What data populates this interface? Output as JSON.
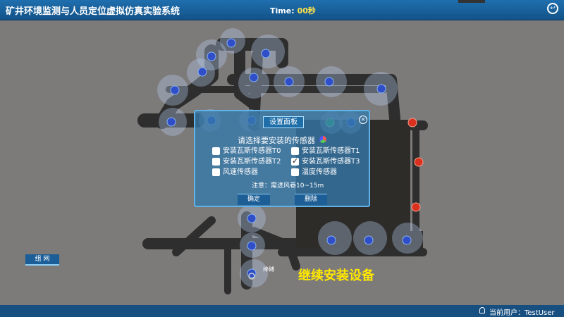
{
  "app": {
    "title": "矿井环境监测与人员定位虚拟仿真实验系统",
    "time_label": "Time:",
    "time_value": "00秒"
  },
  "panel": {
    "title": "设置面板",
    "prompt": "请选择要安装的传感器",
    "options": [
      {
        "label": "安装瓦斯传感器T0",
        "checked": false
      },
      {
        "label": "安装瓦斯传感器T1",
        "checked": false
      },
      {
        "label": "安装瓦斯传感器T2",
        "checked": false
      },
      {
        "label": "安装瓦斯传感器T3",
        "checked": true
      },
      {
        "label": "风速传感器",
        "checked": false
      },
      {
        "label": "温度传感器",
        "checked": false
      }
    ],
    "note": "注意：需进风巷10~15m",
    "confirm_label": "确定",
    "delete_label": "删除"
  },
  "map": {
    "status_message": "继续安装设备",
    "small_label": "绛磗",
    "network_button": "组 网"
  },
  "footer": {
    "user_label": "当前用户：TestUser"
  },
  "colors": {
    "header": "#1a5f9c",
    "panel_border": "#5fb3e8",
    "sensor_blue": "#2f4ec8",
    "sensor_red": "#d9301f",
    "sensor_green": "#33c060",
    "status_text": "#ffe800"
  }
}
